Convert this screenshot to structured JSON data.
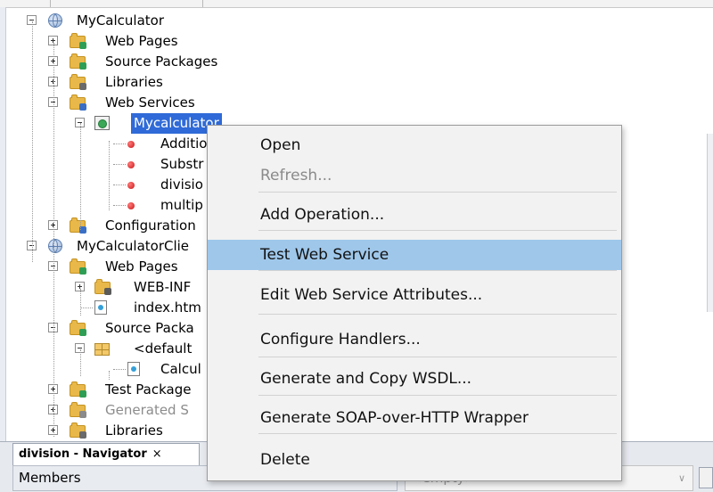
{
  "tree": {
    "rows": [
      {
        "label": "MyCalculator",
        "icon": "globe-icon",
        "toggle": "minus"
      },
      {
        "label": "Web Pages",
        "icon": "folder-icon",
        "toggle": "plus"
      },
      {
        "label": "Source Packages",
        "icon": "folder-icon",
        "toggle": "plus"
      },
      {
        "label": "Libraries",
        "icon": "folder-icon",
        "toggle": "plus"
      },
      {
        "label": "Web Services",
        "icon": "folder-icon",
        "toggle": "minus"
      },
      {
        "label": "Mycalculator",
        "icon": "web-service-icon",
        "toggle": "minus",
        "selected": true
      },
      {
        "label": "Additio",
        "icon": "operation-icon"
      },
      {
        "label": "Substr",
        "icon": "operation-icon"
      },
      {
        "label": "divisio",
        "icon": "operation-icon"
      },
      {
        "label": "multip",
        "icon": "operation-icon"
      },
      {
        "label": "Configuration",
        "icon": "folder-icon",
        "toggle": "plus"
      },
      {
        "label": "MyCalculatorClie",
        "icon": "globe-icon",
        "toggle": "minus"
      },
      {
        "label": "Web Pages",
        "icon": "folder-icon",
        "toggle": "minus"
      },
      {
        "label": "WEB-INF",
        "icon": "folder-icon",
        "toggle": "plus"
      },
      {
        "label": "index.htm",
        "icon": "html-file-icon"
      },
      {
        "label": "Source Packa",
        "icon": "folder-icon",
        "toggle": "minus"
      },
      {
        "label": "<default",
        "icon": "package-icon",
        "toggle": "minus"
      },
      {
        "label": "Calcul",
        "icon": "java-file-icon"
      },
      {
        "label": "Test Package",
        "icon": "folder-icon",
        "toggle": "plus"
      },
      {
        "label": "Generated S",
        "icon": "folder-icon",
        "toggle": "plus",
        "dim": true
      },
      {
        "label": "Libraries",
        "icon": "folder-icon",
        "toggle": "plus"
      }
    ]
  },
  "context_menu": {
    "items": [
      {
        "label": "Open"
      },
      {
        "label": "Refresh...",
        "disabled": true
      },
      {
        "label": "Add Operation..."
      },
      {
        "label": "Test Web Service",
        "highlighted": true
      },
      {
        "label": "Edit Web Service Attributes..."
      },
      {
        "label": "Configure Handlers..."
      },
      {
        "label": "Generate and Copy WSDL..."
      },
      {
        "label": "Generate SOAP-over-HTTP Wrapper"
      },
      {
        "label": "Delete"
      }
    ]
  },
  "navigator": {
    "tab_label": "division - Navigator",
    "close_glyph": "×",
    "members_label": "Members",
    "empty_label": "<empty>",
    "dropdown_glyph": "∨"
  },
  "colors": {
    "selection": "#2f6ad8",
    "menu_highlight": "#9fc7ea",
    "menu_background": "#f2f2f2",
    "disabled_text": "#8a8a8a"
  }
}
